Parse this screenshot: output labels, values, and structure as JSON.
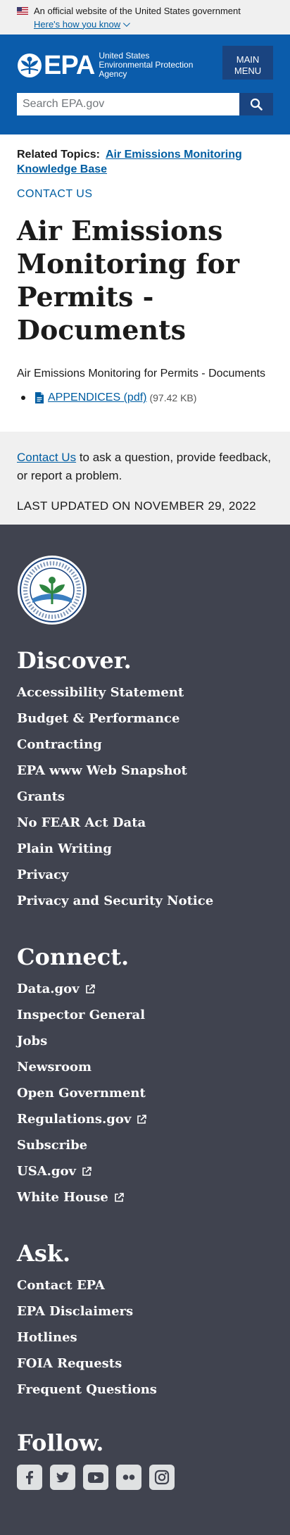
{
  "banner": {
    "official_text": "An official website of the United States government",
    "howto_label": "Here's how you know"
  },
  "header": {
    "logo_text": "EPA",
    "agency_name": "United States Environmental Protection Agency",
    "menu_label": "MAIN MENU",
    "search_placeholder": "Search EPA.gov"
  },
  "main": {
    "related_label": "Related Topics:",
    "related_link": "Air Emissions Monitoring Knowledge Base",
    "contact_us_label": "CONTACT US",
    "page_title": "Air Emissions Monitoring for Permits - Documents",
    "intro": "Air Emissions Monitoring for Permits - Documents",
    "documents": [
      {
        "label": "APPENDICES (pdf)",
        "size": "(97.42 KB)"
      }
    ]
  },
  "contact_box": {
    "link": "Contact Us",
    "text": " to ask a question, provide feedback, or report a problem.",
    "last_updated": "LAST UPDATED ON NOVEMBER 29, 2022"
  },
  "footer": {
    "seal_alt": "United States Environmental Protection Agency",
    "discover": {
      "heading": "Discover.",
      "links": [
        "Accessibility Statement",
        "Budget & Performance",
        "Contracting",
        "EPA www Web Snapshot",
        "Grants",
        "No FEAR Act Data",
        "Plain Writing",
        "Privacy",
        "Privacy and Security Notice"
      ]
    },
    "connect": {
      "heading": "Connect.",
      "links": [
        "Data.gov",
        "Inspector General",
        "Jobs",
        "Newsroom",
        "Open Government",
        "Regulations.gov",
        "Subscribe",
        "USA.gov",
        "White House"
      ]
    },
    "ask": {
      "heading": "Ask.",
      "links": [
        "Contact EPA",
        "EPA Disclaimers",
        "Hotlines",
        "FOIA Requests",
        "Frequent Questions"
      ]
    },
    "follow": {
      "heading": "Follow.",
      "social": [
        "facebook-icon",
        "twitter-icon",
        "youtube-icon",
        "flickr-icon",
        "instagram-icon"
      ]
    }
  },
  "colors": {
    "header_blue": "#0b5cab",
    "button_navy": "#1a4480",
    "link_blue": "#005ea2",
    "footer_bg": "#40434f",
    "banner_bg": "#f0f0f0"
  }
}
